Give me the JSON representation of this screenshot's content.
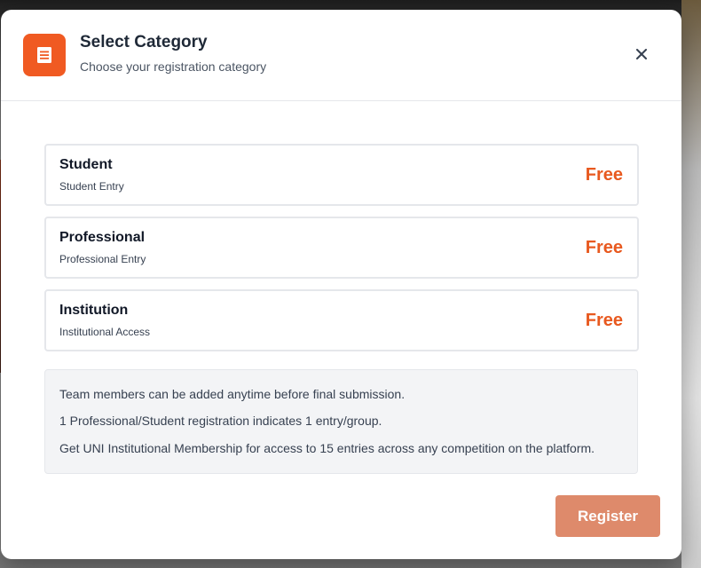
{
  "modal": {
    "title": "Select Category",
    "subtitle": "Choose your registration category",
    "header_icon": "document-icon",
    "close_icon": "close-icon"
  },
  "categories": [
    {
      "name": "Student",
      "description": "Student Entry",
      "price": "Free"
    },
    {
      "name": "Professional",
      "description": "Professional Entry",
      "price": "Free"
    },
    {
      "name": "Institution",
      "description": "Institutional Access",
      "price": "Free"
    }
  ],
  "info": {
    "lines": [
      "Team members can be added anytime before final submission.",
      "1 Professional/Student registration indicates 1 entry/group.",
      "Get UNI Institutional Membership for access to 15 entries across any competition on the platform."
    ]
  },
  "footer": {
    "register_label": "Register"
  },
  "colors": {
    "accent": "#f05a22",
    "price": "#e8591f",
    "register_button": "#de8a6b"
  }
}
